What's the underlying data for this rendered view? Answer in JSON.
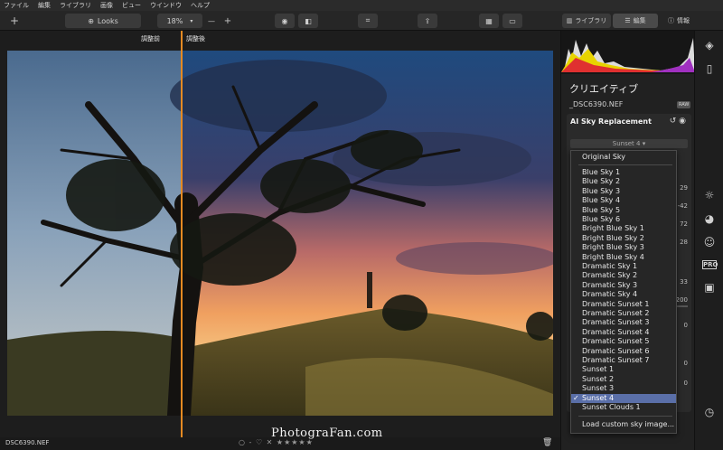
{
  "menu": [
    "ファイル",
    "編集",
    "ライブラリ",
    "画像",
    "ビュー",
    "ウインドウ",
    "ヘルプ"
  ],
  "toolbar": {
    "add_label": "+",
    "looks_label": "Looks",
    "zoom_value": "18%",
    "zoom_minus": "—",
    "zoom_plus": "+",
    "tab_library": "ライブラリ",
    "tab_edit": "編集",
    "tab_info": "情報"
  },
  "canvas": {
    "before_label": "調整前",
    "after_label": "調整後",
    "watermark": "PhotograFan.com"
  },
  "bottom": {
    "filename": "DSC6390.NEF",
    "rating_text": "○ - ♡  ✕ ★★★★★"
  },
  "panel": {
    "title": "クリエイティブ",
    "filename": "_DSC6390.NEF",
    "raw_badge": "RAW",
    "tool_name": "AI Sky Replacement",
    "selected_sky": "Sunset 4",
    "slider_values": [
      "29",
      "-42",
      "72",
      "28",
      "33",
      "200",
      "0",
      "0",
      "0"
    ]
  },
  "sky_menu": {
    "items": [
      "Original Sky",
      "Blue Sky 1",
      "Blue Sky 2",
      "Blue Sky 3",
      "Blue Sky 4",
      "Blue Sky 5",
      "Blue Sky 6",
      "Bright Blue Sky 1",
      "Bright Blue Sky 2",
      "Bright Blue Sky 3",
      "Bright Blue Sky 4",
      "Dramatic Sky 1",
      "Dramatic Sky 2",
      "Dramatic Sky 3",
      "Dramatic Sky 4",
      "Dramatic Sunset 1",
      "Dramatic Sunset 2",
      "Dramatic Sunset 3",
      "Dramatic Sunset 4",
      "Dramatic Sunset 5",
      "Dramatic Sunset 6",
      "Dramatic Sunset 7",
      "Sunset 1",
      "Sunset 2",
      "Sunset 3",
      "Sunset 4",
      "Sunset Clouds 1"
    ],
    "selected": "Sunset 4",
    "load_custom": "Load custom sky image..."
  },
  "colors": {
    "accent": "#e58a22",
    "selection": "#5a6fa8"
  },
  "icons": [
    "layers-icon",
    "compare-icon",
    "sun-icon",
    "palette-icon",
    "face-icon",
    "pro-icon",
    "briefcase-icon",
    "clock-icon"
  ]
}
